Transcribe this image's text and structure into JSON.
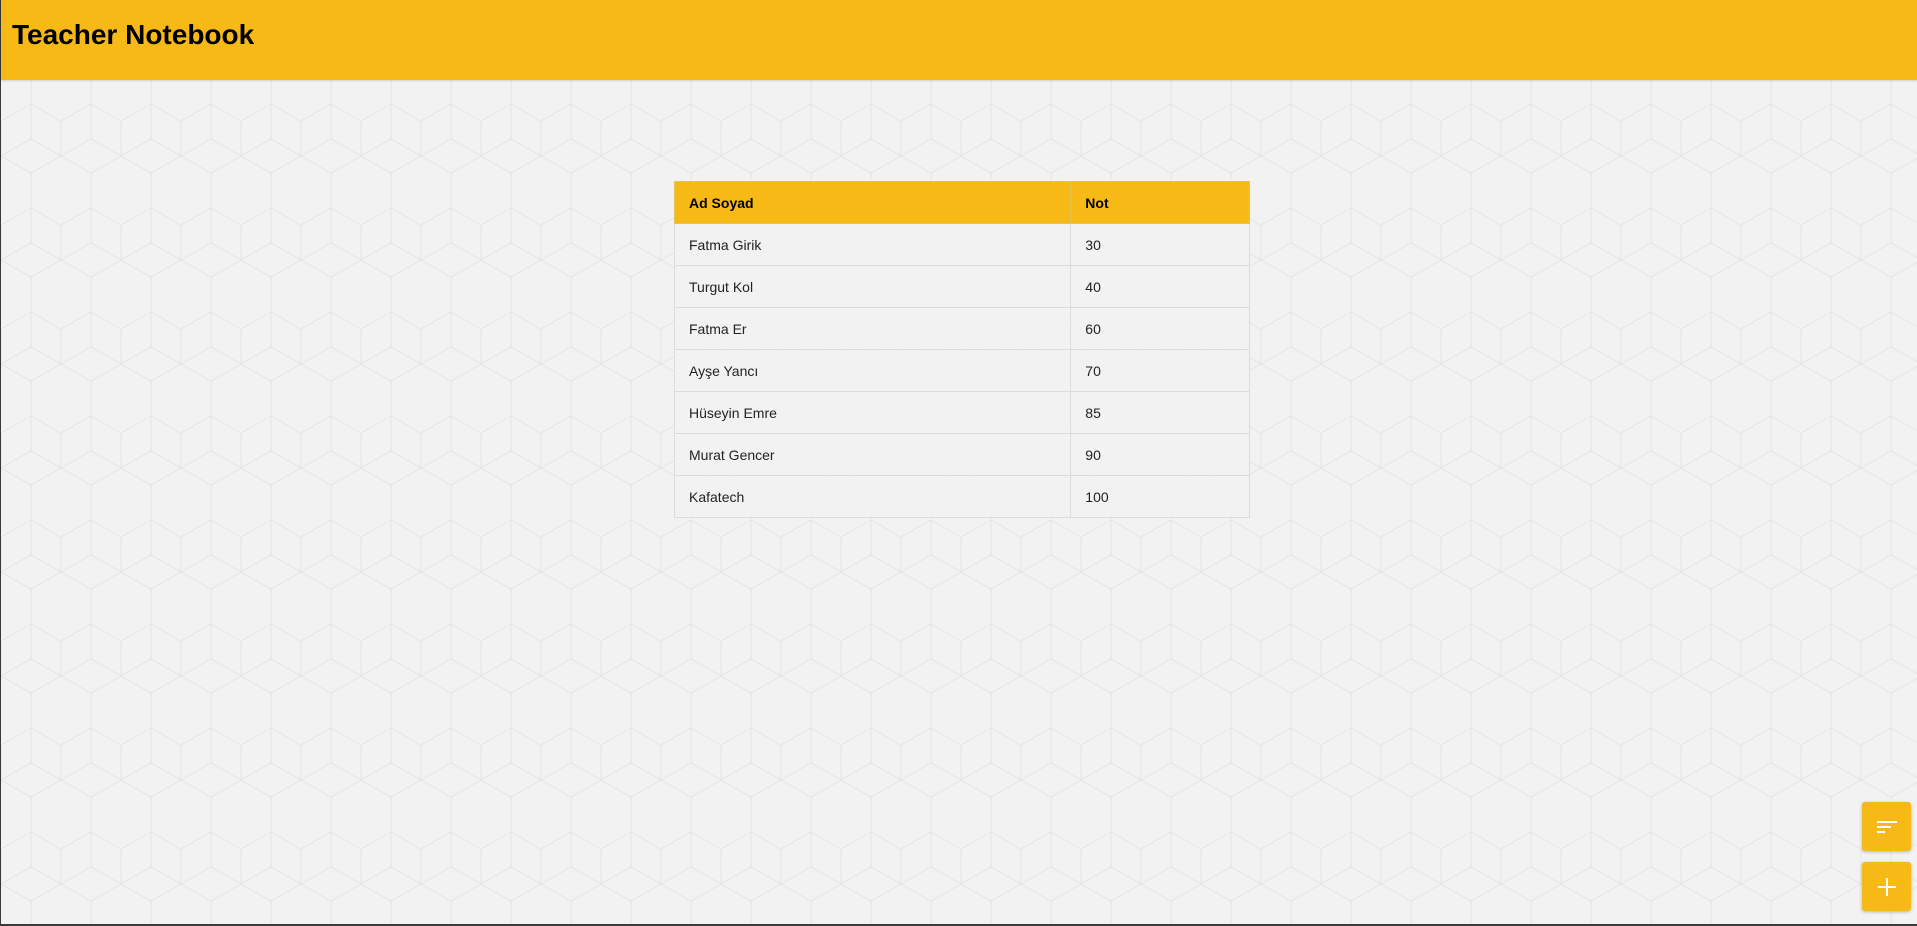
{
  "app": {
    "title": "Teacher Notebook"
  },
  "colors": {
    "accent": "#f6b915",
    "background": "#f2f2f2"
  },
  "table": {
    "headers": [
      "Ad Soyad",
      "Not"
    ],
    "rows": [
      {
        "name": "Fatma Girik",
        "grade": "30"
      },
      {
        "name": "Turgut Kol",
        "grade": "40"
      },
      {
        "name": "Fatma Er",
        "grade": "60"
      },
      {
        "name": "Ayşe Yancı",
        "grade": "70"
      },
      {
        "name": "Hüseyin Emre",
        "grade": "85"
      },
      {
        "name": "Murat Gencer",
        "grade": "90"
      },
      {
        "name": "Kafatech",
        "grade": "100"
      }
    ]
  },
  "actions": {
    "sort_icon": "sort-icon",
    "add_icon": "plus-icon"
  }
}
